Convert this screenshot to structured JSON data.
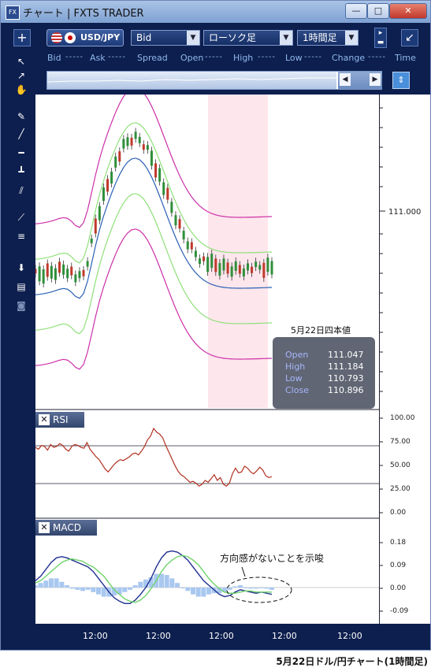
{
  "window": {
    "title": "チャート | FXTS TRADER",
    "app_icon": "FX",
    "buttons": [
      "—",
      "□",
      "✕"
    ]
  },
  "toolbar": {
    "add_label": "+",
    "symbol": "USD/JPY",
    "price_type": "Bid",
    "chart_type": "ローソク足",
    "timeframe": "1時間足",
    "collapse_label": "↙"
  },
  "header": {
    "bid_label": "Bid",
    "bid_value": "-----",
    "ask_label": "Ask",
    "ask_value": "-----",
    "spread_label": "Spread",
    "open_label": "Open",
    "open_value": "-----",
    "high_label": "High",
    "high_value": "-----",
    "low_label": "Low",
    "low_value": "-----",
    "change_label": "Change",
    "change_value": "-----",
    "time_label": "Time"
  },
  "price_axis": {
    "label": "111.000"
  },
  "info_box": {
    "title": "5月22日四本値",
    "rows": [
      {
        "label": "Open",
        "value": "111.047"
      },
      {
        "label": "High",
        "value": "111.184"
      },
      {
        "label": "Low",
        "value": "110.793"
      },
      {
        "label": "Close",
        "value": "110.896"
      }
    ]
  },
  "rsi": {
    "title": "RSI",
    "ticks": [
      "100.00",
      "75.00",
      "50.00",
      "25.00",
      "0.00"
    ],
    "values": [
      70,
      68,
      72,
      71,
      67,
      73,
      70,
      71,
      74,
      72,
      68,
      66,
      71,
      73,
      72,
      70,
      69,
      75,
      68,
      64,
      60,
      57,
      52,
      47,
      44,
      48,
      52,
      55,
      57,
      56,
      58,
      60,
      63,
      64,
      62,
      66,
      71,
      78,
      82,
      90,
      86,
      84,
      80,
      72,
      65,
      58,
      51,
      45,
      41,
      39,
      36,
      33,
      34,
      32,
      29,
      31,
      35,
      33,
      37,
      41,
      35,
      38,
      31,
      29,
      32,
      42,
      48,
      43,
      44,
      50,
      48,
      44,
      42,
      45,
      49,
      46,
      40,
      38,
      39
    ]
  },
  "macd": {
    "title": "MACD",
    "ticks": [
      "0.18",
      "0.09",
      "0.00",
      "-0.09"
    ],
    "macd_line": [
      0.03,
      0.05,
      0.08,
      0.11,
      0.13,
      0.135,
      0.13,
      0.12,
      0.11,
      0.1,
      0.09,
      0.07,
      0.04,
      0.01,
      -0.02,
      -0.045,
      -0.06,
      -0.07,
      -0.07,
      -0.055,
      -0.03,
      0.0,
      0.04,
      0.09,
      0.13,
      0.155,
      0.16,
      0.155,
      0.14,
      0.12,
      0.09,
      0.06,
      0.03,
      0.01,
      -0.01,
      -0.03,
      -0.04,
      -0.035,
      -0.02,
      -0.01,
      -0.015,
      -0.02,
      -0.025,
      -0.02,
      -0.025,
      -0.03
    ],
    "signal_line": [
      0.02,
      0.03,
      0.05,
      0.07,
      0.09,
      0.11,
      0.12,
      0.125,
      0.12,
      0.115,
      0.1,
      0.09,
      0.07,
      0.05,
      0.02,
      -0.01,
      -0.03,
      -0.05,
      -0.06,
      -0.065,
      -0.055,
      -0.035,
      -0.005,
      0.03,
      0.07,
      0.1,
      0.12,
      0.135,
      0.14,
      0.135,
      0.12,
      0.1,
      0.07,
      0.04,
      0.015,
      -0.005,
      -0.02,
      -0.025,
      -0.025,
      -0.02,
      -0.015,
      -0.015,
      -0.02,
      -0.02,
      -0.02,
      -0.02
    ],
    "histogram": [
      0.01,
      0.02,
      0.03,
      0.04,
      0.04,
      0.025,
      0.01,
      -0.005,
      -0.01,
      -0.015,
      -0.01,
      -0.02,
      -0.03,
      -0.04,
      -0.04,
      -0.035,
      -0.03,
      -0.02,
      -0.01,
      0.01,
      0.025,
      0.035,
      0.045,
      0.06,
      0.06,
      0.055,
      0.04,
      0.02,
      0.0,
      -0.015,
      -0.03,
      -0.04,
      -0.04,
      -0.03,
      -0.025,
      -0.025,
      -0.02,
      -0.01,
      0.005,
      0.01,
      0.0,
      -0.005,
      -0.005,
      0.0,
      -0.005,
      -0.01
    ]
  },
  "annotation": "方向感がないことを示唆",
  "x_labels": [
    "12:00",
    "12:00",
    "12:00",
    "12:00",
    "12:00"
  ],
  "caption": "5月22日ドル/円チャート(1時間足)",
  "colors": {
    "background": "#0d1f4e",
    "upper_lower_band": "#cc2fa8",
    "inner_band": "#8fe07a",
    "mid_line": "#2a5fb3",
    "candle_up": "#2f8f3a",
    "candle_down": "#c0392b",
    "rsi_line": "#b23020",
    "macd_line": "#1f2f8f",
    "signal_line": "#6fd36a",
    "histogram": "#a9c8f0",
    "highlight": "#fde6ec"
  }
}
